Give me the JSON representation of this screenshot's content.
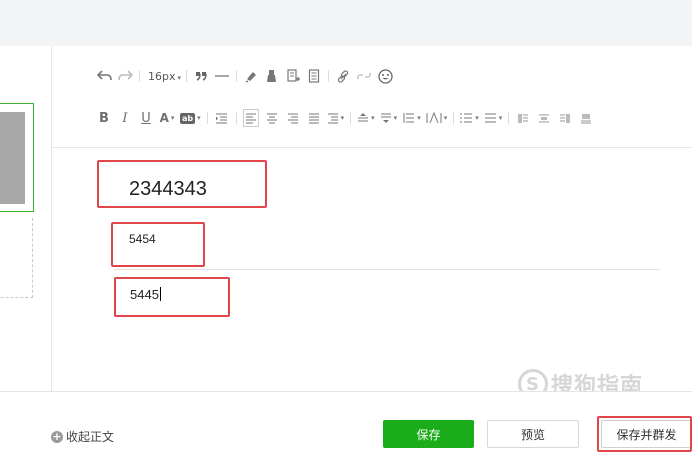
{
  "toolbar": {
    "font_size": "16px",
    "caret": "▾",
    "bold": "B",
    "italic": "I",
    "underline": "U",
    "font_color": "A",
    "bg_color": "ab",
    "icons_row1": [
      "undo-icon",
      "redo-icon",
      "quote-icon",
      "horizontal-rule-icon",
      "format-painter-icon",
      "clear-format-icon",
      "insert-template-icon",
      "document-icon",
      "link-icon",
      "unlink-icon",
      "emoji-icon"
    ],
    "icons_row2": [
      "indent-icon",
      "align-left-icon",
      "align-center-icon",
      "align-right-icon",
      "justify-icon",
      "first-line-indent-icon",
      "spacing-before-icon",
      "spacing-after-icon",
      "line-height-icon",
      "letter-spacing-icon",
      "ordered-list-icon",
      "unordered-list-icon",
      "layout-1-icon",
      "layout-2-icon",
      "layout-3-icon",
      "layout-4-icon"
    ]
  },
  "content": {
    "line1": "2344343",
    "line2": "5454",
    "line3": "5445"
  },
  "footer": {
    "collapse_label": "收起正文",
    "save_label": "保存",
    "preview_label": "预览",
    "save_and_send_label": "保存并群发"
  },
  "watermark": {
    "logo_letter": "S",
    "text": "搜狗指南"
  },
  "colors": {
    "accent_green": "#1aad19",
    "highlight_red": "#e0454a",
    "topbar_bg": "#f3f4f6"
  }
}
